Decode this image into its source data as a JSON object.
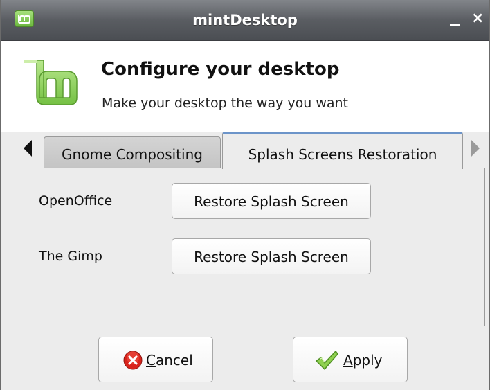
{
  "window": {
    "title": "mintDesktop",
    "minimize_glyph": "_",
    "close_glyph": "×"
  },
  "header": {
    "title": "Configure your desktop",
    "subtitle": "Make your desktop the way you want",
    "logo_icon": "linux-mint-logo"
  },
  "tabs": [
    {
      "label": "Gnome Compositing",
      "active": false
    },
    {
      "label": "Splash Screens Restoration",
      "active": true
    }
  ],
  "splash_rows": [
    {
      "label": "OpenOffice",
      "button": "Restore Splash Screen"
    },
    {
      "label": "The Gimp",
      "button": "Restore Splash Screen"
    }
  ],
  "buttons": {
    "cancel": {
      "label_mnemonic": "C",
      "label_rest": "ancel",
      "icon": "cancel-icon"
    },
    "apply": {
      "label_mnemonic": "A",
      "label_rest": "pply",
      "icon": "checkmark-icon"
    }
  },
  "colors": {
    "accent": "#6cb83f",
    "titlebar": "#5a5d62",
    "tab_highlight": "#6c94c9",
    "cancel_red": "#d9231b"
  }
}
